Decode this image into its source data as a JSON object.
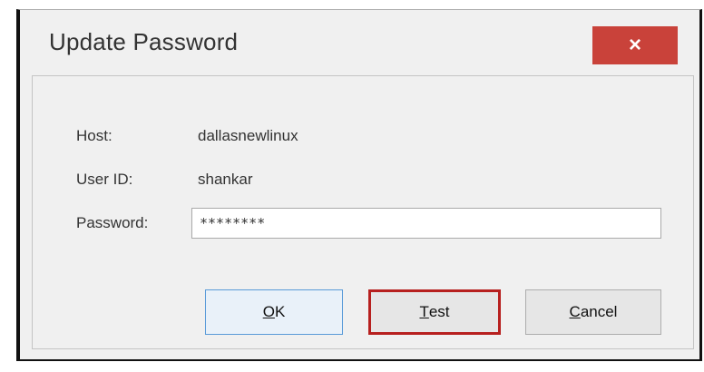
{
  "dialog": {
    "title": "Update Password",
    "close_label": "×"
  },
  "fields": {
    "host_label": "Host:",
    "host_value": "dallasnewlinux",
    "userid_label": "User ID:",
    "userid_value": "shankar",
    "password_label": "Password:",
    "password_value": "********"
  },
  "buttons": {
    "ok_mnemonic": "O",
    "ok_rest": "K",
    "test_mnemonic": "T",
    "test_rest": "est",
    "cancel_mnemonic": "C",
    "cancel_rest": "ancel"
  },
  "colors": {
    "close_button": "#c9423a",
    "focus_highlight": "#b7201f",
    "default_button_border": "#5a9bd8"
  }
}
